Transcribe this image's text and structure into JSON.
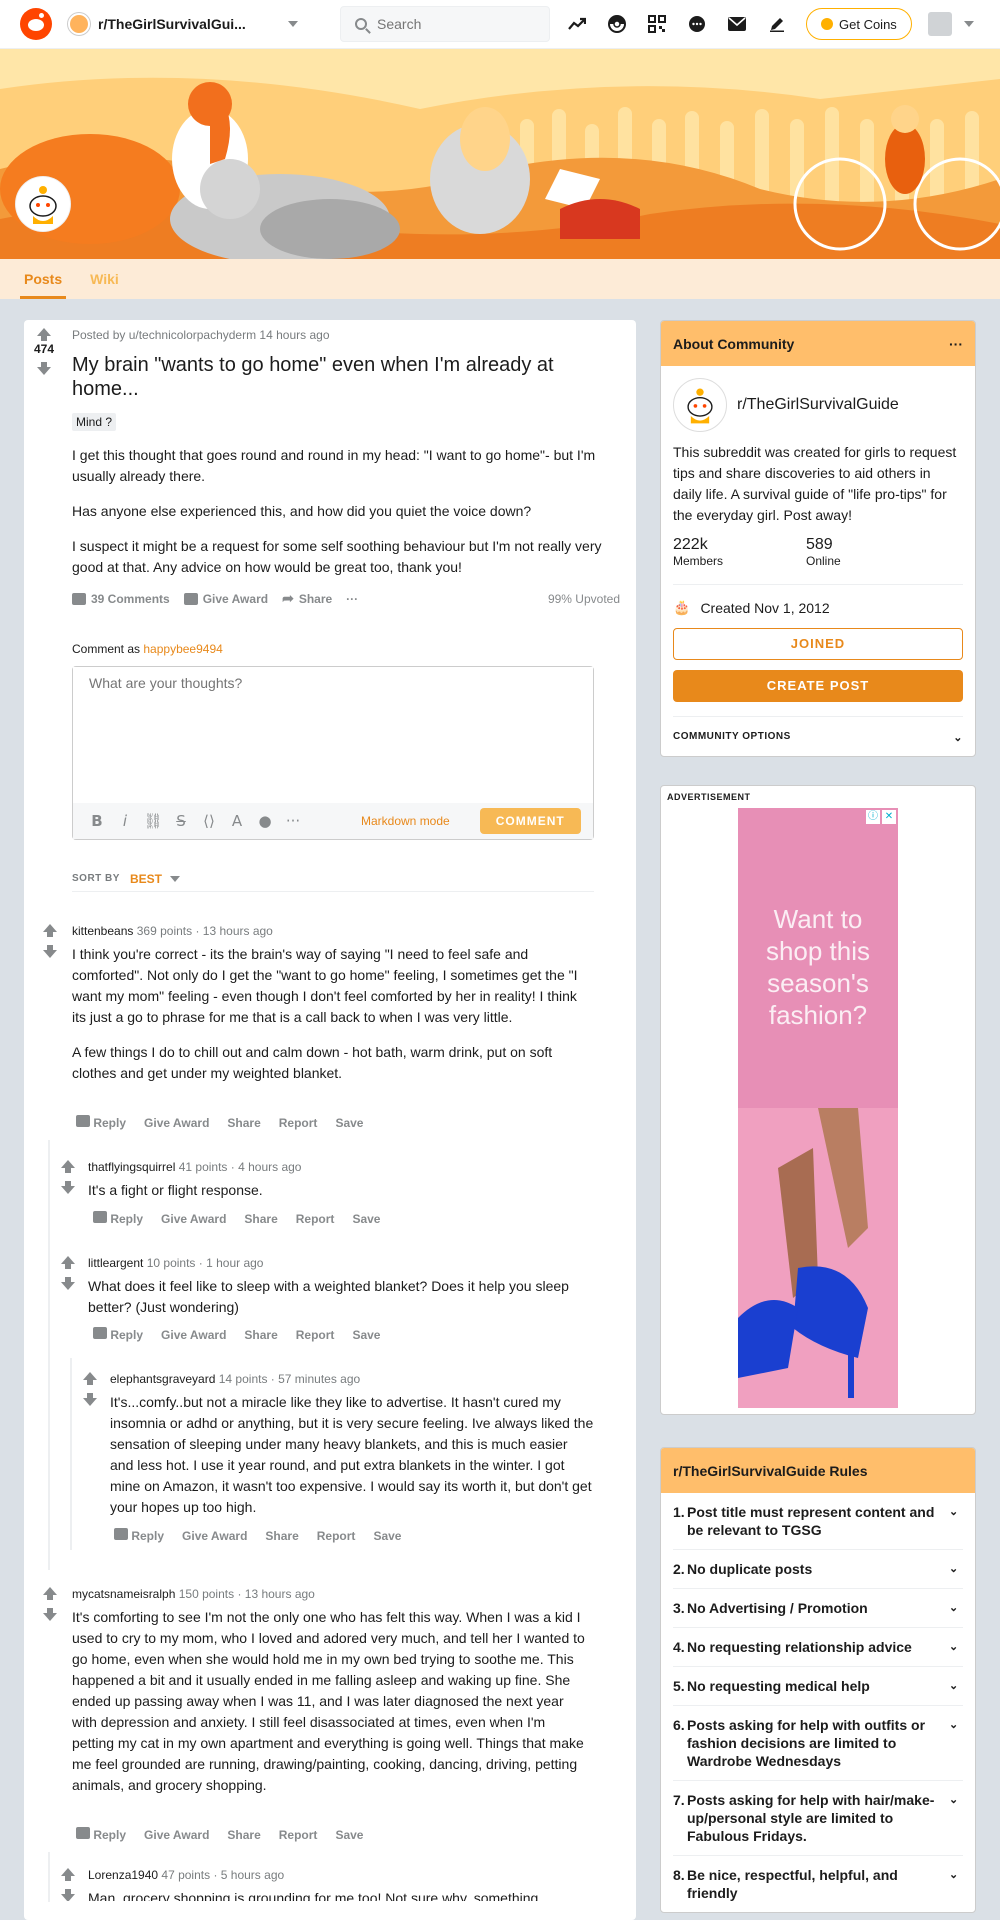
{
  "topbar": {
    "subreddit": "r/TheGirlSurvivalGui...",
    "search_placeholder": "Search",
    "coins_label": "Get Coins",
    "icons": [
      "trending-icon",
      "popular-icon",
      "qr-icon",
      "chat-icon",
      "mail-icon",
      "pencil-icon"
    ]
  },
  "tabs": [
    "Posts",
    "Wiki"
  ],
  "post": {
    "score": "474",
    "meta": "Posted by u/technicolorpachyderm 14 hours ago",
    "title": "My brain \"wants to go home\" even when I'm already at home...",
    "flair": "Mind ?",
    "paragraphs": [
      "I get this thought that goes round and round in my head: \"I want to go home\"- but I'm usually already there.",
      "Has anyone else experienced this, and how did you quiet the voice down?",
      "I suspect it might be a request for some self soothing behaviour but I'm not really very good at that. Any advice on how would be great too, thank you!"
    ],
    "comments_label": "39 Comments",
    "award_label": "Give Award",
    "share_label": "Share",
    "more_label": "···",
    "upvoted": "99% Upvoted"
  },
  "comment_box": {
    "as_label": "Comment as",
    "username": "happybee9494",
    "placeholder": "What are your thoughts?",
    "markdown": "Markdown mode",
    "submit": "COMMENT",
    "sort_label": "SORT BY",
    "sort_value": "BEST"
  },
  "comment_actions": {
    "reply": "Reply",
    "award": "Give Award",
    "share": "Share",
    "report": "Report",
    "save": "Save"
  },
  "comments": [
    {
      "author": "kittenbeans",
      "points": "369 points",
      "time": "13 hours ago",
      "paragraphs": [
        "I think you're correct - its the brain's way of saying \"I need to feel safe and comforted\". Not only do I get the \"want to go home\" feeling, I sometimes get the \"I want my mom\" feeling - even though I don't feel comforted by her in reality! I think its just a go to phrase for me that is a call back to when I was very little.",
        "A few things I do to chill out and calm down - hot bath, warm drink, put on soft clothes and get under my weighted blanket."
      ]
    },
    {
      "author": "thatflyingsquirrel",
      "points": "41 points",
      "time": "4 hours ago",
      "paragraphs": [
        "It's a fight or flight response."
      ]
    },
    {
      "author": "littleargent",
      "points": "10 points",
      "time": "1 hour ago",
      "paragraphs": [
        "What does it feel like to sleep with a weighted blanket? Does it help you sleep better? (Just wondering)"
      ]
    },
    {
      "author": "elephantsgraveyard",
      "points": "14 points",
      "time": "57 minutes ago",
      "paragraphs": [
        "It's...comfy..but not a miracle like they like to advertise. It hasn't cured my insomnia or adhd or anything, but it is very secure feeling. Ive always liked the sensation of sleeping under many heavy blankets, and this is much easier and less hot. I use it year round, and put extra blankets in the winter. I got mine on Amazon, it wasn't too expensive. I would say its worth it, but don't get your hopes up too high."
      ]
    },
    {
      "author": "mycatsnameisralph",
      "points": "150 points",
      "time": "13 hours ago",
      "paragraphs": [
        "It's comforting to see I'm not the only one who has felt this way. When I was a kid I used to cry to my mom, who I loved and adored very much, and tell her I wanted to go home, even when she would hold me in my own bed trying to soothe me. This happened a bit and it usually ended in me falling asleep and waking up fine. She ended up passing away when I was 11, and I was later diagnosed the next year with depression and anxiety. I still feel disassociated at times, even when I'm petting my cat in my own apartment and everything is going well. Things that make me feel grounded are running, drawing/painting, cooking, dancing, driving, petting animals, and grocery shopping."
      ]
    },
    {
      "author": "Lorenza1940",
      "points": "47 points",
      "time": "5 hours ago",
      "paragraphs": [
        "Man, grocery shopping is grounding for me too! Not sure why, something"
      ]
    }
  ],
  "about": {
    "heading": "About Community",
    "name": "r/TheGirlSurvivalGuide",
    "description": "This subreddit was created for girls to request tips and share discoveries to aid others in daily life. A survival guide of \"life pro-tips\" for the everyday girl. Post away!",
    "members_value": "222k",
    "members_label": "Members",
    "online_value": "589",
    "online_label": "Online",
    "created": "Created Nov 1, 2012",
    "joined": "JOINED",
    "create_post": "CREATE POST",
    "options": "COMMUNITY OPTIONS"
  },
  "ad": {
    "label": "ADVERTISEMENT",
    "text": "Want to shop this season's fashion?"
  },
  "rules": {
    "heading": "r/TheGirlSurvivalGuide Rules",
    "items": [
      {
        "n": "1.",
        "t": "Post title must represent content and be relevant to TGSG"
      },
      {
        "n": "2.",
        "t": "No duplicate posts"
      },
      {
        "n": "3.",
        "t": "No Advertising / Promotion"
      },
      {
        "n": "4.",
        "t": "No requesting relationship advice"
      },
      {
        "n": "5.",
        "t": "No requesting medical help"
      },
      {
        "n": "6.",
        "t": "Posts asking for help with outfits or fashion decisions are limited to Wardrobe Wednesdays"
      },
      {
        "n": "7.",
        "t": "Posts asking for help with hair/make-up/personal style are limited to Fabulous Fridays."
      },
      {
        "n": "8.",
        "t": "Be nice, respectful, helpful, and friendly"
      }
    ]
  }
}
